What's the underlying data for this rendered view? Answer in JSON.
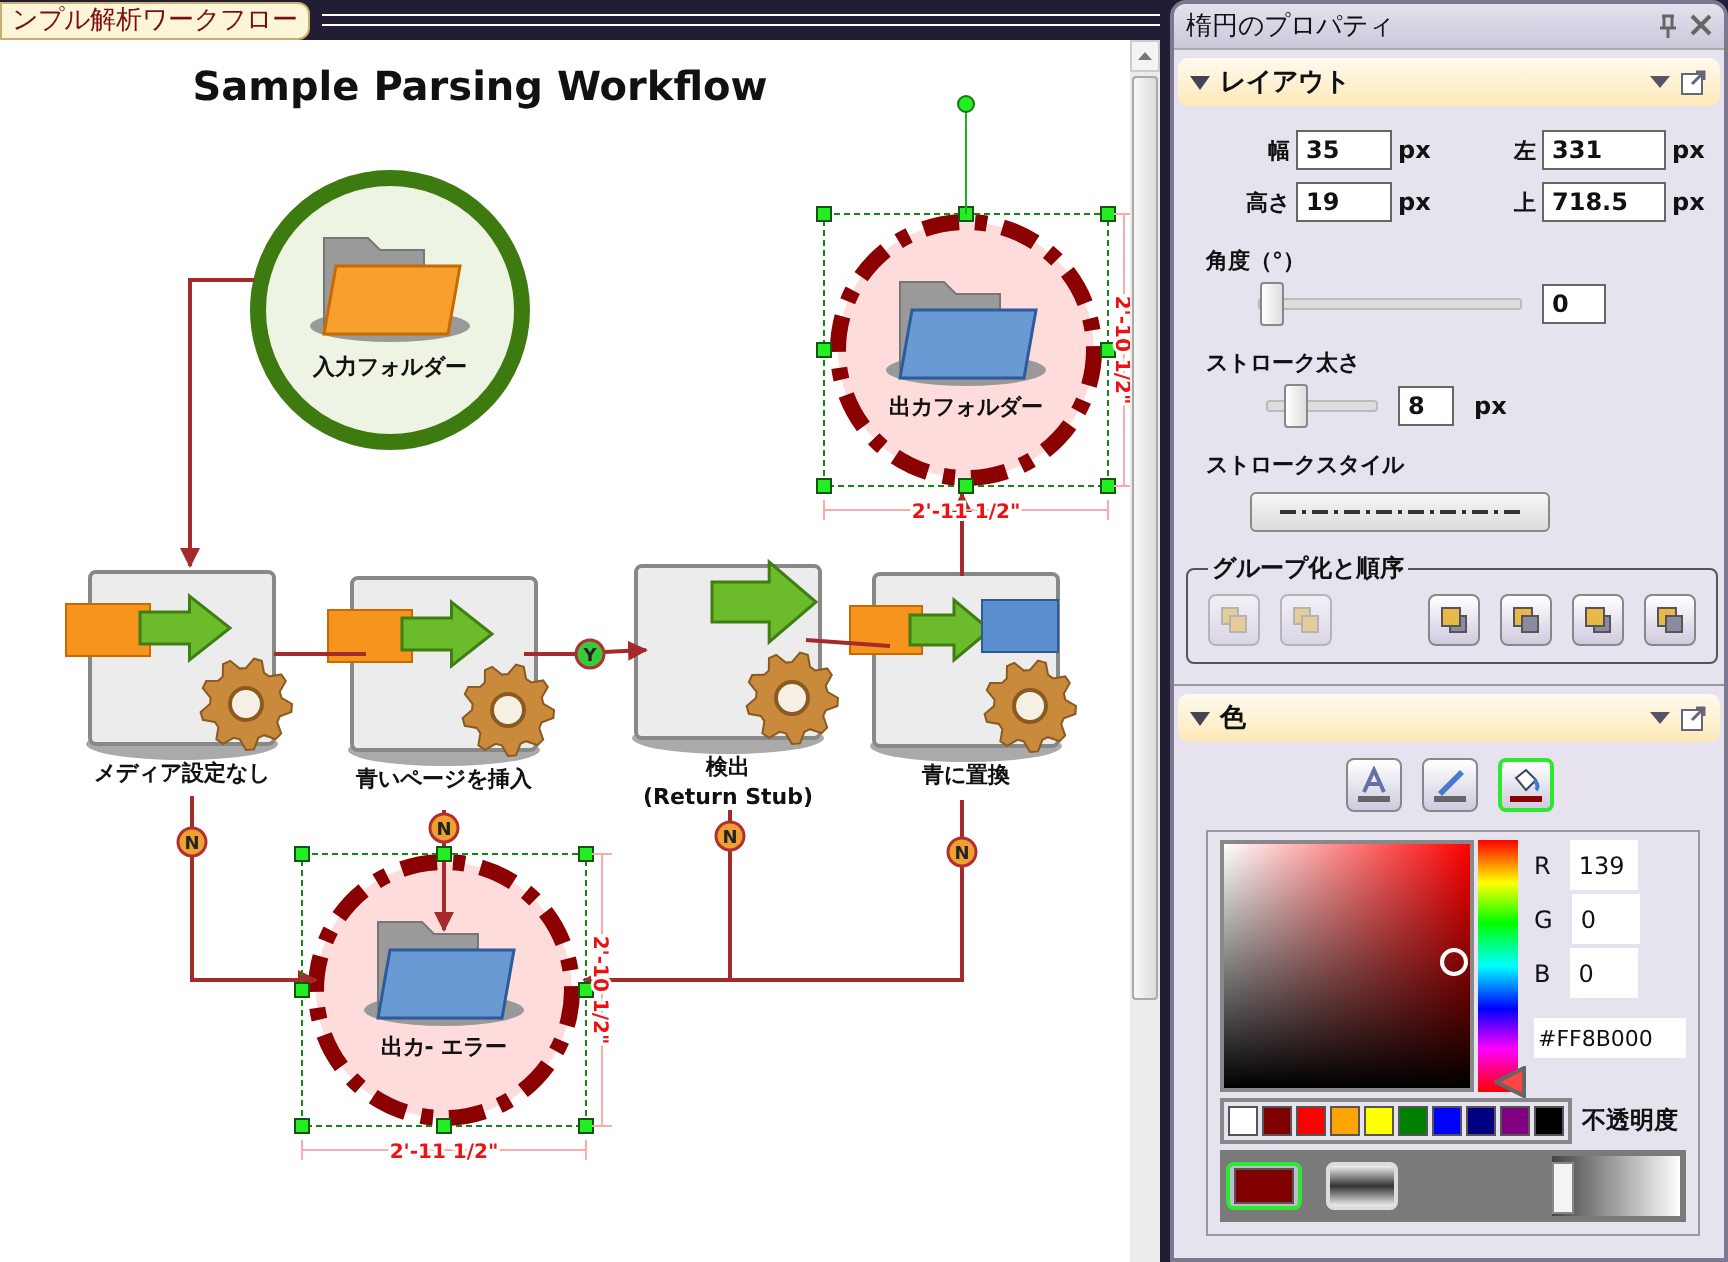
{
  "tab": {
    "label": "ンプル解析ワークフロー"
  },
  "canvas": {
    "title": "Sample Parsing Workflow",
    "nodes": [
      {
        "kind": "folder-in",
        "label_lines": [
          "入力フォルダー"
        ],
        "selected": false
      },
      {
        "kind": "folder-out",
        "label_lines": [
          "出カフォルダー"
        ],
        "selected": true,
        "width_label": "2'-11 1/2\"",
        "height_label": "2'-10 1/2\""
      },
      {
        "kind": "process",
        "label_lines": [
          "メディア設定なし"
        ],
        "selected": false
      },
      {
        "kind": "process",
        "label_lines": [
          "青いページを挿入"
        ],
        "selected": false
      },
      {
        "kind": "detect",
        "label_lines": [
          "検出",
          "(Return Stub)"
        ],
        "selected": false
      },
      {
        "kind": "replace",
        "label_lines": [
          "青に置換"
        ],
        "selected": false
      },
      {
        "kind": "folder-out",
        "label_lines": [
          "出カ- エラー"
        ],
        "selected": true,
        "width_label": "2'-11 1/2\"",
        "height_label": "2'-10 1/2\""
      }
    ],
    "badges": [
      {
        "label": "Y",
        "color": "#3cc83c"
      },
      {
        "label": "N",
        "color": "#f0a030"
      },
      {
        "label": "N",
        "color": "#f0a030"
      },
      {
        "label": "N",
        "color": "#f0a030"
      },
      {
        "label": "N",
        "color": "#f0a030"
      }
    ]
  },
  "panel": {
    "title": "楕円のプロパティ",
    "layout": {
      "title": "レイアウト",
      "expanded": true,
      "fields": [
        {
          "label": "幅",
          "value": "35",
          "unit": "px"
        },
        {
          "label": "左",
          "value": "331",
          "unit": "px"
        },
        {
          "label": "高さ",
          "value": "19",
          "unit": "px"
        },
        {
          "label": "上",
          "value": "718.5",
          "unit": "px"
        }
      ],
      "angle": {
        "label": "角度（°）",
        "level": 0,
        "value": "0"
      },
      "stroke_width": {
        "label": "ストローク太さ",
        "level": 0.2,
        "value": "8",
        "unit": "px"
      },
      "stroke_style": {
        "label": "ストロークスタイル"
      }
    },
    "group": {
      "title": "グループ化と順序",
      "buttons": [
        {
          "kind": "group",
          "disabled": true
        },
        {
          "kind": "ungroup",
          "disabled": true
        },
        {
          "kind": "forward",
          "disabled": false
        },
        {
          "kind": "backward",
          "disabled": false
        },
        {
          "kind": "front",
          "disabled": false
        },
        {
          "kind": "back",
          "disabled": false
        }
      ]
    },
    "color": {
      "title": "色",
      "expanded": true,
      "targets": [
        {
          "kind": "text",
          "selected": false
        },
        {
          "kind": "line",
          "selected": false
        },
        {
          "kind": "fill",
          "selected": true
        }
      ],
      "channels": [
        {
          "label": "R",
          "value": "139"
        },
        {
          "label": "G",
          "value": "0"
        },
        {
          "label": "B",
          "value": "0"
        }
      ],
      "hex": "#FF8B000",
      "swatches": [
        {
          "color": "#ffffff"
        },
        {
          "color": "#800000"
        },
        {
          "color": "#ff0000"
        },
        {
          "color": "#ffa500"
        },
        {
          "color": "#ffff00"
        },
        {
          "color": "#008000"
        },
        {
          "color": "#0000ff"
        },
        {
          "color": "#000080"
        },
        {
          "color": "#800080"
        },
        {
          "color": "#000000"
        }
      ],
      "opacity_label": "不透明度",
      "fill_button": {
        "selected": true,
        "color": "#800000"
      },
      "opacity": {
        "level": 0
      }
    }
  }
}
